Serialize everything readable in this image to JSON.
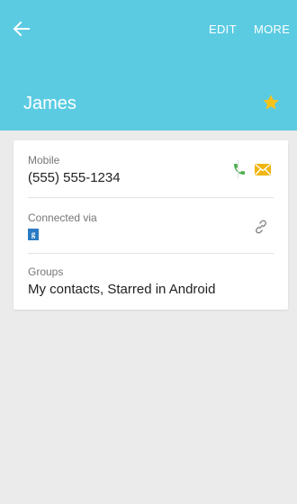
{
  "header": {
    "edit_label": "EDIT",
    "more_label": "MORE",
    "contact_name": "James",
    "starred": true
  },
  "details": {
    "mobile": {
      "label": "Mobile",
      "value": "(555) 555-1234"
    },
    "connected": {
      "label": "Connected via",
      "service_icon": "google-plus-icon"
    },
    "groups": {
      "label": "Groups",
      "value": "My contacts, Starred in Android"
    }
  },
  "colors": {
    "header_bg": "#5bcbe2",
    "star": "#f7c31b",
    "phone_icon": "#4caf50",
    "mail_icon": "#f2b50f",
    "page_bg": "#ebebeb"
  }
}
